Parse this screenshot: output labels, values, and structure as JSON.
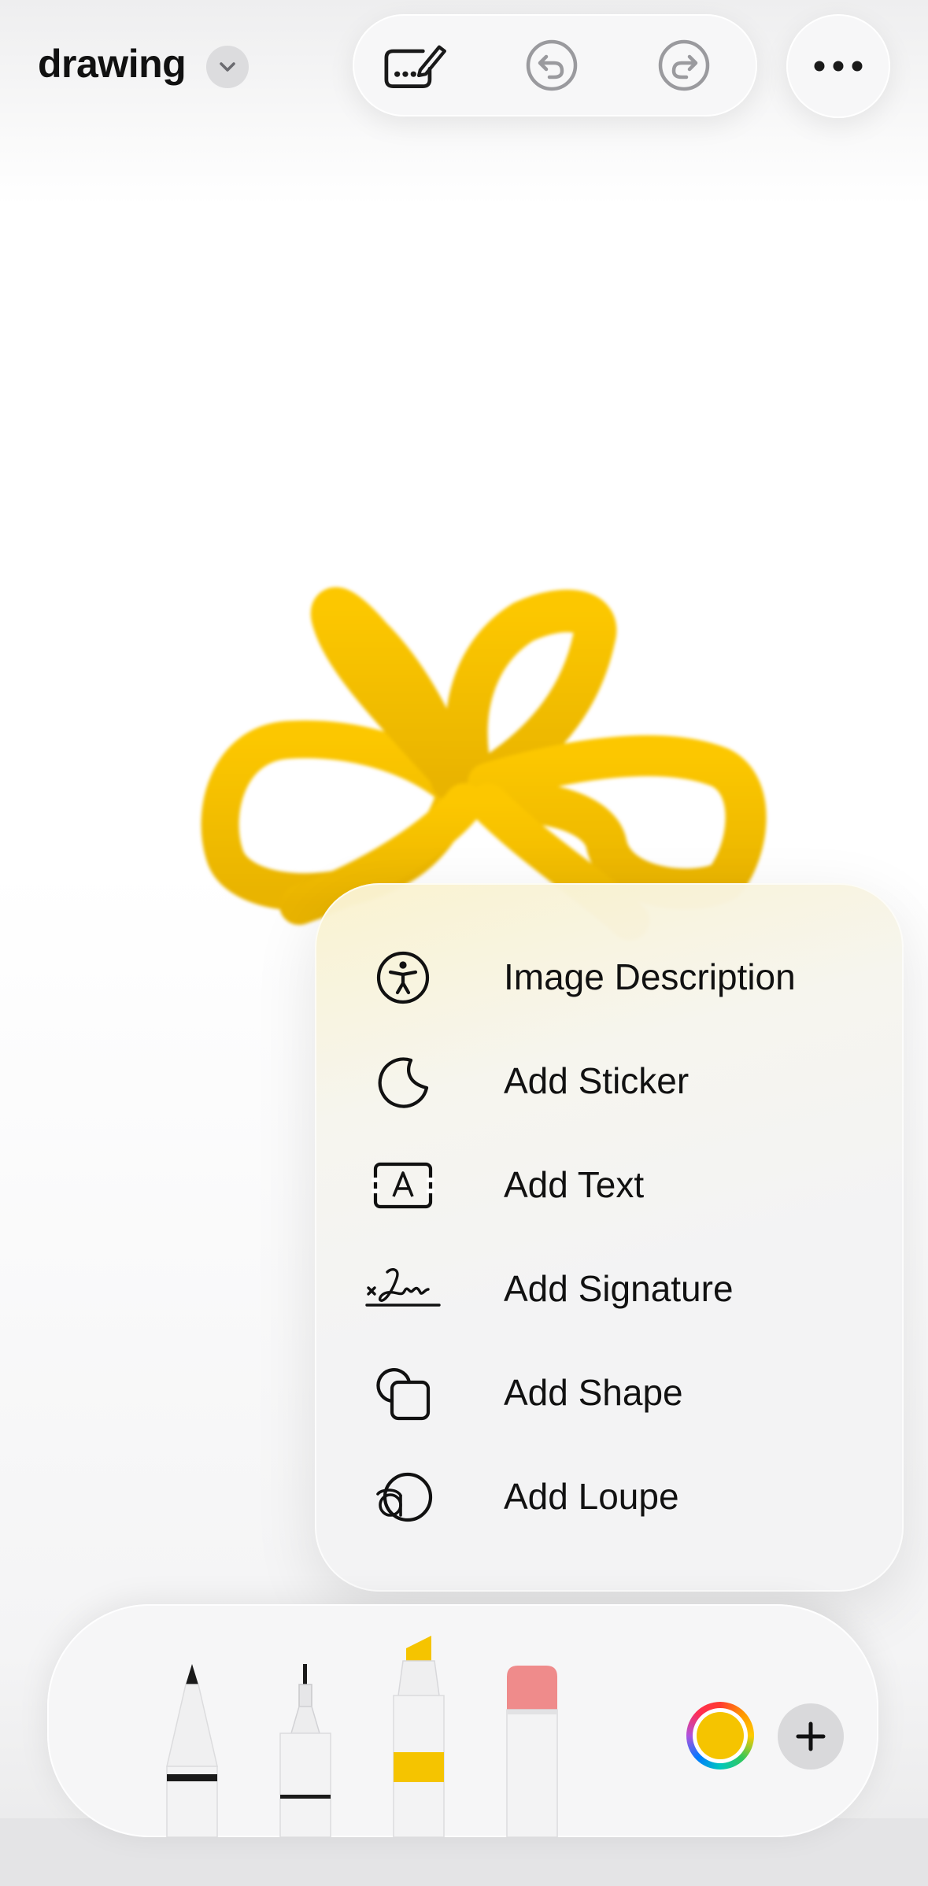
{
  "document": {
    "title": "drawing"
  },
  "toolbar": {
    "icons": [
      "ellipsis-pencil-icon",
      "undo-icon",
      "redo-icon",
      "more-icon"
    ]
  },
  "menu": {
    "items": [
      {
        "label": "Image Description",
        "icon": "accessibility-icon"
      },
      {
        "label": "Add Sticker",
        "icon": "sticker-icon"
      },
      {
        "label": "Add Text",
        "icon": "text-box-icon"
      },
      {
        "label": "Add Signature",
        "icon": "signature-icon"
      },
      {
        "label": "Add Shape",
        "icon": "shapes-icon"
      },
      {
        "label": "Add Loupe",
        "icon": "loupe-icon"
      }
    ]
  },
  "tools": {
    "items": [
      "pen",
      "fineliner",
      "marker",
      "eraser"
    ],
    "current_color": "#f5c400"
  },
  "colors": {
    "drawing_stroke": "#f5c400",
    "menu_text": "#111111"
  }
}
